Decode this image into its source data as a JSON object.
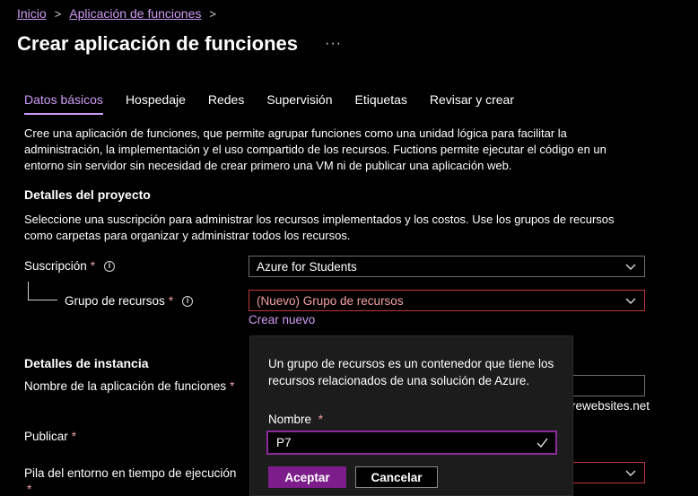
{
  "breadcrumb": {
    "home": "Inicio",
    "current": "Aplicación de funciones"
  },
  "page": {
    "title": "Crear aplicación de funciones",
    "more": "···"
  },
  "tabs": [
    {
      "label": "Datos básicos",
      "active": true
    },
    {
      "label": "Hospedaje"
    },
    {
      "label": "Redes"
    },
    {
      "label": "Supervisión"
    },
    {
      "label": "Etiquetas"
    },
    {
      "label": "Revisar y crear"
    }
  ],
  "intro": "Cree una aplicación de funciones, que permite agrupar funciones como una unidad lógica para facilitar la administración, la implementación y el uso compartido de los recursos. Fuctions permite ejecutar el código en un entorno sin servidor sin necesidad de crear primero una VM ni de publicar una aplicación web.",
  "project": {
    "title": "Detalles del proyecto",
    "description": "Seleccione una suscripción para administrar los recursos implementados y los costos. Use los grupos de recursos como carpetas para organizar y administrar todos los recursos.",
    "subscription_label": "Suscripción",
    "subscription_value": "Azure for Students",
    "resource_group_label": "Grupo de recursos",
    "resource_group_value": "(Nuevo) Grupo de recursos",
    "create_new": "Crear nuevo"
  },
  "instance": {
    "title": "Detalles de instancia",
    "app_name_label": "Nombre de la aplicación de funciones",
    "domain_suffix": "rewebsites.net",
    "publish_label": "Publicar",
    "runtime_label": "Pila del entorno en tiempo de ejecución"
  },
  "required_marker": "*",
  "callout": {
    "text": "Un grupo de recursos es un contenedor que tiene los recursos relacionados de una solución de Azure.",
    "name_label": "Nombre",
    "name_value": "P7",
    "accept": "Aceptar",
    "cancel": "Cancelar"
  },
  "colors": {
    "accent": "#ce9bf5",
    "primary_button": "#7c1d8b",
    "error_border": "#c0353a"
  }
}
